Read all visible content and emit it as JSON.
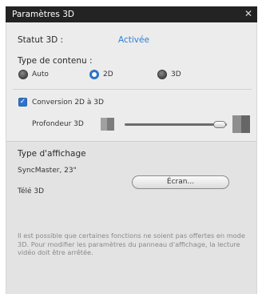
{
  "window": {
    "title": "Paramètres 3D",
    "close_symbol": "✕"
  },
  "status": {
    "label": "Statut 3D :",
    "value": "Activée",
    "value_color": "#2f7fd3"
  },
  "content_type": {
    "heading": "Type de contenu :",
    "options": [
      {
        "label": "Auto",
        "selected": false
      },
      {
        "label": "2D",
        "selected": true
      },
      {
        "label": "3D",
        "selected": false
      }
    ]
  },
  "conversion": {
    "label": "Conversion 2D à 3D",
    "checked": true
  },
  "depth": {
    "label": "Profondeur 3D",
    "level": 0.93
  },
  "display": {
    "heading": "Type d'affichage",
    "device1": "SyncMaster, 23\"",
    "device2": "Télé 3D",
    "button_label": "Écran..."
  },
  "note": "Il est possible que certaines fonctions ne soient pas offertes en mode 3D. Pour modifier les paramètres du panneau d'affichage, la lecture vidéo doit être arrêtée."
}
